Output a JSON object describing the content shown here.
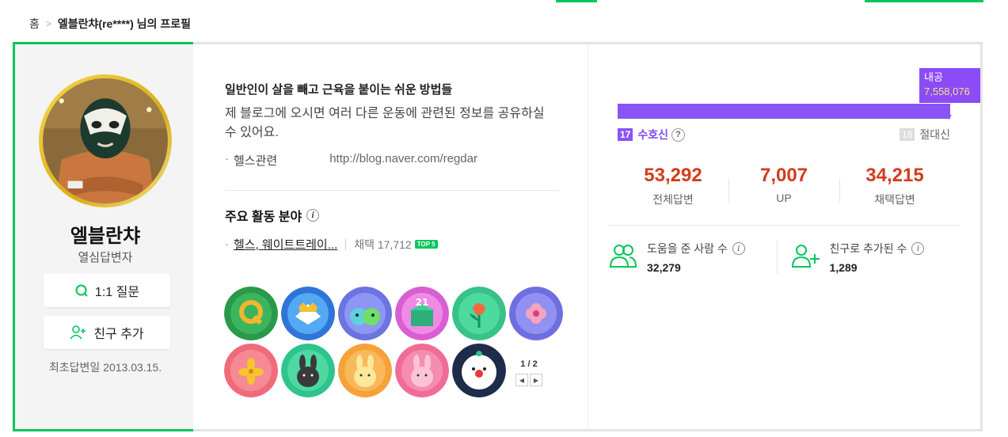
{
  "breadcrumb": {
    "home": "홈",
    "current": "엘블란챠(re****) 님의 프로필"
  },
  "profile": {
    "nickname": "엘블란챠",
    "grade": "열심답변자",
    "question_btn": "1:1 질문",
    "friend_btn": "친구 추가",
    "first_answer": "최초답변일 2013.03.15."
  },
  "intro": {
    "title": "일반인이 살을 빼고 근육을 붙이는 쉬운 방법들",
    "text": "제 블로그에 오시면 여러 다른 운동에 관련된 정보를 공유하실 수 있어요.",
    "link_label": "헬스관련",
    "link_url": "http://blog.naver.com/regdar"
  },
  "activity": {
    "title": "주요 활동 분야",
    "field": "헬스, 웨이트트레이...",
    "adopt": "채택 17,712",
    "badge": "TOP 5"
  },
  "badges": {
    "page": "1 / 2",
    "items": [
      "22nd-anniversary-badge",
      "solutionist-badge",
      "make-it-together-badge",
      "21st-anniversary-badge",
      "spring-tulip-badge",
      "spring-flower-badge",
      "spring-forsythia-badge",
      "2023-black-rabbit-badge",
      "2023-yellow-rabbit-badge",
      "2023-pink-rabbit-badge",
      "jolly-badge"
    ]
  },
  "level": {
    "tip_label": "내공",
    "tip_value": "7,558,076",
    "current_num": "17",
    "current_name": "수호신",
    "next_num": "18",
    "next_name": "절대신",
    "bar_color": "#8a53f5"
  },
  "stats": [
    {
      "value": "53,292",
      "label": "전체답변"
    },
    {
      "value": "7,007",
      "label": "UP"
    },
    {
      "value": "34,215",
      "label": "채택답변"
    }
  ],
  "fans": {
    "helped_label": "도움을 준 사람 수",
    "helped_value": "32,279",
    "friend_label": "친구로 추가된 수",
    "friend_value": "1,289"
  },
  "colors": {
    "accent": "#03c75a",
    "stat": "#d33b1c",
    "level": "#8a53f5"
  }
}
